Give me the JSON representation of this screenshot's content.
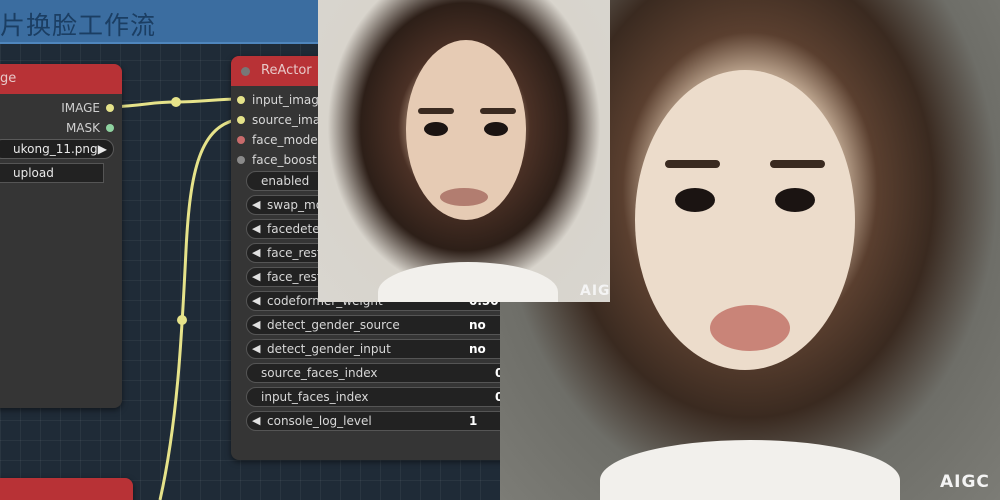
{
  "group": {
    "title": "片换脸工作流"
  },
  "load_image_node": {
    "title": "ge",
    "outputs": [
      {
        "label": "IMAGE",
        "color": "#e6e38a"
      },
      {
        "label": "MASK",
        "color": "#8fd3a0"
      }
    ],
    "image_value": "ukong_11.png",
    "upload_label": "upload"
  },
  "reactor_node": {
    "title": "ReActor",
    "inputs": [
      {
        "label": "input_image",
        "color": "#e6e38a"
      },
      {
        "label": "source_imag",
        "color": "#e6e38a"
      },
      {
        "label": "face_model",
        "color": "#c96b6b"
      },
      {
        "label": "face_boost",
        "color": "#8a8a8a"
      }
    ],
    "widgets": [
      {
        "label": "enabled",
        "value": "",
        "arrow": false
      },
      {
        "label": "swap_mo",
        "value": "",
        "arrow": true
      },
      {
        "label": "facedetec",
        "value": "",
        "arrow": true
      },
      {
        "label": "face_resto",
        "value": "",
        "arrow": true
      },
      {
        "label": "face_resto",
        "value": "",
        "arrow": true
      },
      {
        "label": "codeformer_weight",
        "value": "0.50",
        "arrow": true
      },
      {
        "label": "detect_gender_source",
        "value": "no",
        "arrow": true
      },
      {
        "label": "detect_gender_input",
        "value": "no",
        "arrow": true
      },
      {
        "label": "source_faces_index",
        "value": "0",
        "arrow": false
      },
      {
        "label": "input_faces_index",
        "value": "0",
        "arrow": false
      },
      {
        "label": "console_log_level",
        "value": "1",
        "arrow": true
      }
    ]
  },
  "photos": {
    "left_watermark": "AIGC",
    "right_watermark": "AIGC"
  },
  "icons": {
    "arrow_left": "◀",
    "arrow_right": "▶"
  }
}
